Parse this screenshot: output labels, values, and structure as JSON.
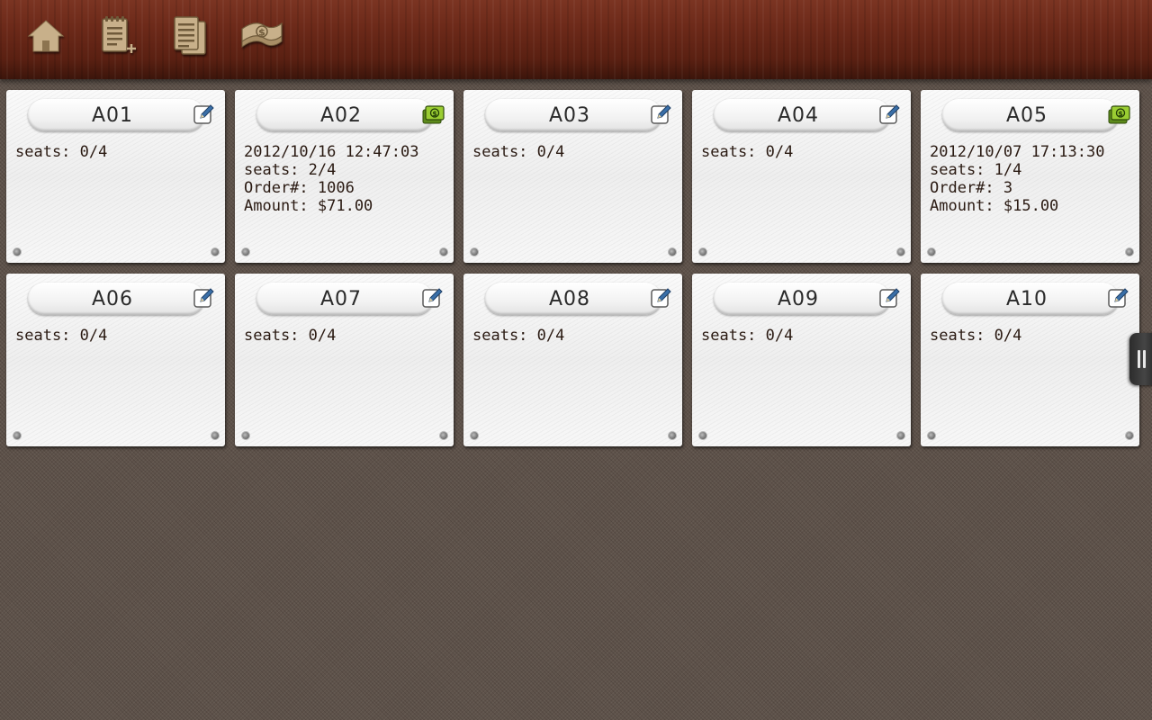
{
  "toolbar": {
    "buttons": [
      {
        "name": "home-button",
        "icon": "home-icon"
      },
      {
        "name": "new-order-button",
        "icon": "notepad-plus-icon"
      },
      {
        "name": "orders-list-button",
        "icon": "documents-stack-icon"
      },
      {
        "name": "cash-button",
        "icon": "money-icon"
      }
    ],
    "icon_color": "#c8b08a"
  },
  "tables": [
    {
      "id": "A01",
      "status": "empty",
      "icon": "edit-icon",
      "lines": [
        "seats: 0/4"
      ]
    },
    {
      "id": "A02",
      "status": "occupied",
      "icon": "cash-icon",
      "lines": [
        "2012/10/16 12:47:03",
        "seats: 2/4",
        "Order#: 1006",
        "Amount: $71.00"
      ]
    },
    {
      "id": "A03",
      "status": "empty",
      "icon": "edit-icon",
      "lines": [
        "seats: 0/4"
      ]
    },
    {
      "id": "A04",
      "status": "empty",
      "icon": "edit-icon",
      "lines": [
        "seats: 0/4"
      ]
    },
    {
      "id": "A05",
      "status": "occupied",
      "icon": "cash-icon",
      "lines": [
        "2012/10/07 17:13:30",
        "seats: 1/4",
        "Order#: 3",
        "Amount: $15.00"
      ]
    },
    {
      "id": "A06",
      "status": "empty",
      "icon": "edit-icon",
      "lines": [
        "seats: 0/4"
      ]
    },
    {
      "id": "A07",
      "status": "empty",
      "icon": "edit-icon",
      "lines": [
        "seats: 0/4"
      ]
    },
    {
      "id": "A08",
      "status": "empty",
      "icon": "edit-icon",
      "lines": [
        "seats: 0/4"
      ]
    },
    {
      "id": "A09",
      "status": "empty",
      "icon": "edit-icon",
      "lines": [
        "seats: 0/4"
      ]
    },
    {
      "id": "A10",
      "status": "empty",
      "icon": "edit-icon",
      "lines": [
        "seats: 0/4"
      ]
    }
  ],
  "colors": {
    "edit_icon": "#3a6fa8",
    "cash_icon": "#9acd32",
    "toolbar_wood": "#6a2818",
    "background": "#5e524a"
  },
  "side_handle": {
    "icon": "pause-bars-icon"
  }
}
